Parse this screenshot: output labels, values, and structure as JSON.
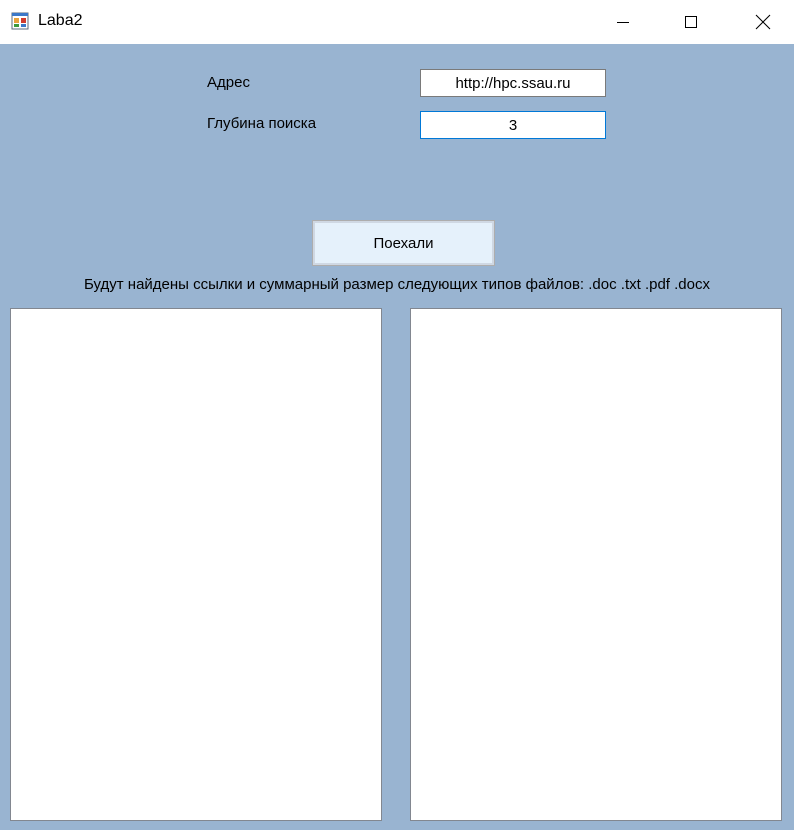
{
  "window": {
    "title": "Laba2",
    "icon": "winforms-app-icon",
    "controls": {
      "minimize": "minimize-icon",
      "maximize": "maximize-icon",
      "close": "close-icon"
    }
  },
  "form": {
    "address_label": "Адрес",
    "address_value": "http://hpc.ssau.ru",
    "depth_label": "Глубина поиска",
    "depth_value": "3",
    "go_button_label": "Поехали",
    "info_text": "Будут найдены ссылки и суммарный размер следующих типов файлов: .doc .txt .pdf .docx"
  },
  "lists": {
    "links": [],
    "sizes": []
  },
  "colors": {
    "client_background": "#99b4d1",
    "focus_border": "#0078d7",
    "button_background": "#e5f1fb"
  }
}
